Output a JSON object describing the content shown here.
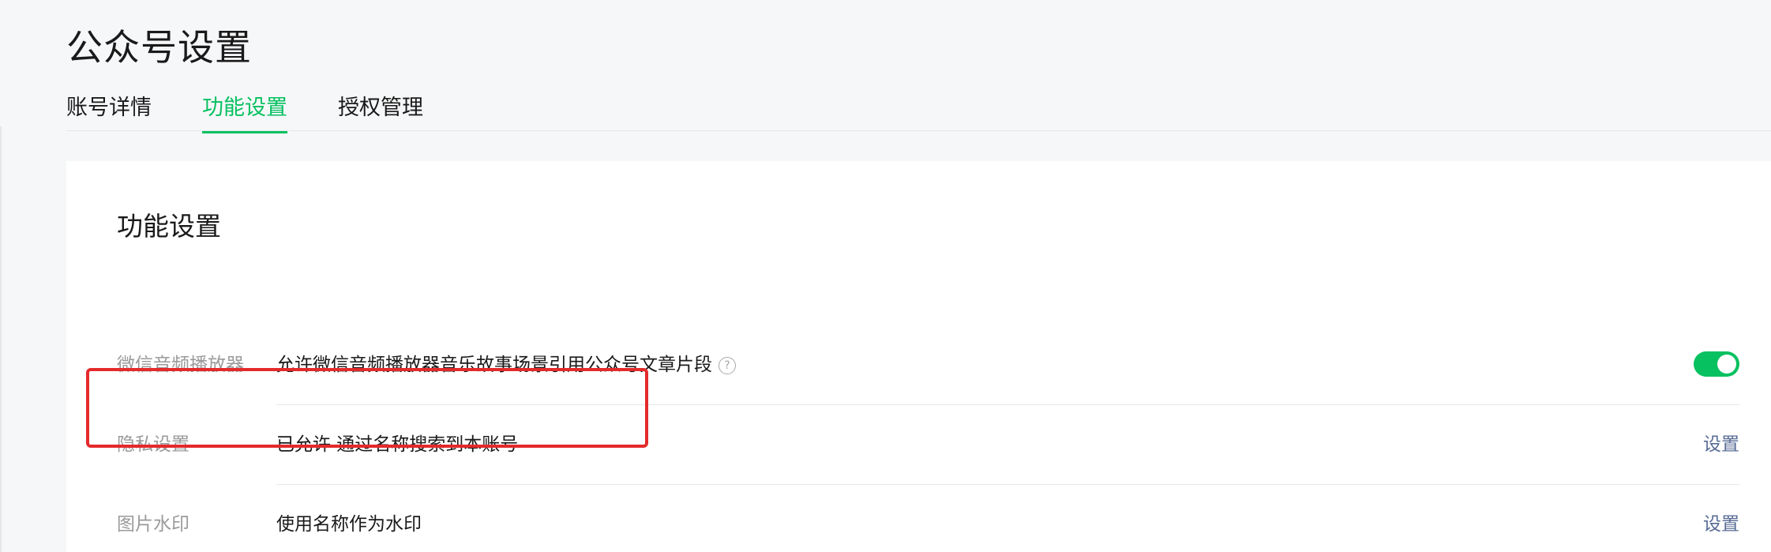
{
  "header": {
    "title": "公众号设置"
  },
  "tabs": [
    {
      "label": "账号详情"
    },
    {
      "label": "功能设置"
    },
    {
      "label": "授权管理"
    }
  ],
  "card": {
    "title": "功能设置",
    "rows": [
      {
        "label": "微信音频播放器",
        "value": "允许微信音频播放器音乐故事场景引用公众号文章片段",
        "help_icon": "?",
        "toggle_on": true
      },
      {
        "label": "隐私设置",
        "value": "已允许 通过名称搜索到本账号",
        "action": "设置"
      },
      {
        "label": "图片水印",
        "value": "使用名称作为水印",
        "action": "设置"
      }
    ]
  },
  "colors": {
    "accent": "#07c160",
    "link": "#576b95",
    "highlight_box": "#e42a2a"
  }
}
